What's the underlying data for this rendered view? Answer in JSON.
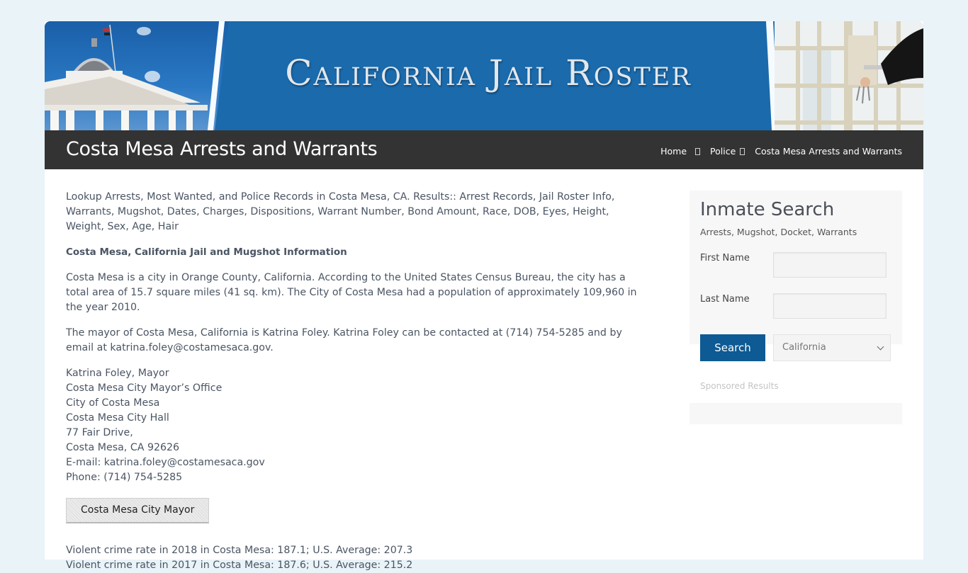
{
  "banner": {
    "site_title": "California Jail Roster",
    "left_image": "capitol-building-photo",
    "right_image": "jail-cell-door-photo"
  },
  "titlebar": {
    "page_title": "Costa Mesa Arrests and Warrants",
    "breadcrumb": [
      {
        "label": "Home"
      },
      {
        "label": "Police"
      },
      {
        "label": "Costa Mesa Arrests and Warrants"
      }
    ],
    "separator_icon": "chevron-right-icon"
  },
  "main": {
    "intro": "Lookup Arrests, Most Wanted, and Police Records in Costa Mesa, CA. Results:: Arrest Records, Jail Roster Info, Warrants, Mugshot, Dates, Charges, Dispositions, Warrant Number, Bond Amount, Race, DOB, Eyes, Height, Weight, Sex, Age, Hair",
    "section_heading": "Costa Mesa, California Jail and Mugshot Information",
    "city_info": "Costa Mesa is a city in Orange County, California. According to the United States Census Bureau, the city has a total area of 15.7 square miles (41 sq. km). The City of Costa Mesa had a population of approximately 109,960 in the year 2010.",
    "mayor_info": "The mayor of Costa Mesa, California is Katrina Foley. Katrina Foley can be contacted at (714) 754-5285 and by email at katrina.foley@costamesaca.gov.",
    "address_lines": [
      "Katrina Foley, Mayor",
      "Costa Mesa City Mayor’s Office",
      "City of Costa Mesa",
      "Costa Mesa City Hall",
      "77 Fair Drive,",
      "Costa Mesa, CA 92626",
      "E-mail: katrina.foley@costamesaca.gov",
      "Phone: (714) 754-5285"
    ],
    "mayor_button": "Costa Mesa City Mayor",
    "crime_lines": [
      "Violent crime rate in 2018 in Costa Mesa: 187.1; U.S. Average: 207.3",
      "Violent crime rate in 2017 in Costa Mesa: 187.6; U.S. Average: 215.2"
    ]
  },
  "sidebar": {
    "title": "Inmate Search",
    "subtitle": "Arrests, Mugshot, Docket, Warrants",
    "first_name_label": "First Name",
    "first_name_value": "",
    "last_name_label": "Last Name",
    "last_name_value": "",
    "search_button": "Search",
    "state_selected": "California",
    "sponsored": "Sponsored Results"
  },
  "colors": {
    "page_background": "#e9f3f8",
    "banner_blue": "#1a6aac",
    "titlebar": "#333333",
    "search_button": "#0d5a94"
  }
}
